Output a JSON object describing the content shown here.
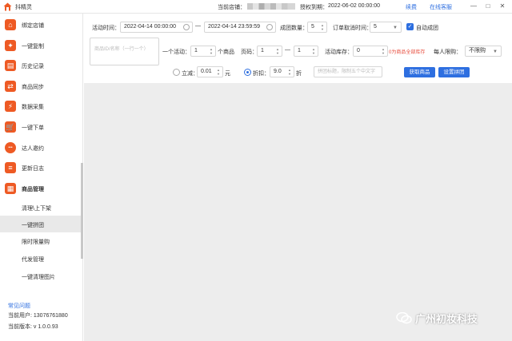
{
  "titlebar": {
    "app_title": "抖精灵",
    "store_label": "当前店铺：",
    "expire_label": "授权到期：",
    "expire_value": "2022-06-02 00:00:00",
    "renew_label": "续费",
    "service_label": "在线客服",
    "minimize": "—",
    "maximize": "□",
    "close": "✕"
  },
  "sidebar": {
    "items": [
      {
        "label": "绑定店铺",
        "icon": "store-icon",
        "glyph": "⌂"
      },
      {
        "label": "一键复制",
        "icon": "shopping-bag-icon",
        "glyph": "✦"
      },
      {
        "label": "历史记录",
        "icon": "history-icon",
        "glyph": "▤"
      },
      {
        "label": "商品同步",
        "icon": "sync-icon",
        "glyph": "⇄"
      },
      {
        "label": "数据采集",
        "icon": "lightning-icon",
        "glyph": "⚡"
      },
      {
        "label": "一键下单",
        "icon": "cart-icon",
        "glyph": "🛒"
      },
      {
        "label": "达人邀约",
        "icon": "chat-dots-icon",
        "glyph": "•••"
      },
      {
        "label": "更新日志",
        "icon": "log-icon",
        "glyph": "≡"
      },
      {
        "label": "商品管理",
        "icon": "grid-icon",
        "glyph": "▦"
      }
    ],
    "sub_items": [
      {
        "label": "清理\\上下架",
        "active": false
      },
      {
        "label": "一键拼团",
        "active": true
      },
      {
        "label": "限时限量购",
        "active": false
      },
      {
        "label": "代发管理",
        "active": false
      },
      {
        "label": "一键清理图片",
        "active": false
      }
    ],
    "faq": "常见问题",
    "user": "当前用户: 13076761880",
    "version": "当前版本: v 1.0.0.93"
  },
  "form": {
    "activity_time_label": "活动时间：",
    "start_time": "2022-04-14 00:00:00",
    "dash": "—",
    "end_time": "2022-04-14 23:59:59",
    "group_count_label": "成团数量：",
    "group_count": "5",
    "cancel_time_label": "订单取消时间：",
    "cancel_time": "5",
    "auto_group_label": "自动成团",
    "product_id_placeholder": "商品ID/名称（一行一个）",
    "one_activity_label": "一个活动：",
    "per_activity": "1",
    "product_unit": "个商品",
    "page_label": "页码：",
    "page_from": "1",
    "page_to": "1",
    "stock_label": "活动库存：",
    "stock": "0",
    "stock_hint": "0为商品全部库存",
    "limit_label": "每人限购：",
    "limit_value": "不限购",
    "instant_label": "立减：",
    "instant_value": "0.01",
    "yuan": "元",
    "discount_label": "折扣：",
    "discount_value": "9.0",
    "discount_unit": "折",
    "title_placeholder": "拼团标题，限制五个中文字",
    "fetch_button": "获取商品",
    "set_button": "设置拼团"
  },
  "watermark": "广州初妆科技",
  "colors": {
    "accent": "#2e6fe0",
    "icon": "#ee5a24",
    "hint": "#e74c3c",
    "content_bg": "#ededed"
  }
}
